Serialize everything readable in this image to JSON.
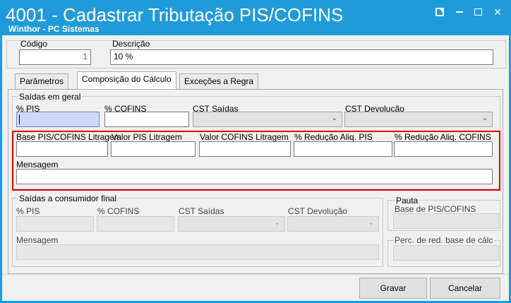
{
  "window": {
    "title": "4001 - Cadastrar Tributação PIS/COFINS",
    "subtitle": "Winthor - PC Sistemas",
    "controls": [
      "edit-icon",
      "minimize-icon",
      "maximize-icon",
      "close-icon"
    ]
  },
  "header": {
    "codigo_label": "Código",
    "codigo_value": "1",
    "descricao_label": "Descrição",
    "descricao_value": "10 %"
  },
  "tabs": [
    {
      "label": "Parâmetros",
      "active": false
    },
    {
      "label": "Composição do Cálculo",
      "active": true
    },
    {
      "label": "Exceções a Regra",
      "active": false
    }
  ],
  "saidas_geral": {
    "title": "Saídas em geral",
    "pis_label": "% PIS",
    "pis_value": "",
    "cofins_label": "% COFINS",
    "cofins_value": "",
    "cst_saidas_label": "CST Saídas",
    "cst_saidas_value": "",
    "cst_devolucao_label": "CST Devolução",
    "cst_devolucao_value": "",
    "base_litragem_label": "Base PIS/COFINS Litragem",
    "valor_pis_litragem_label": "Valor PIS Litragem",
    "valor_cofins_litragem_label": "Valor COFINS Litragem",
    "reducao_pis_label": "% Redução Aliq. PIS",
    "reducao_cofins_label": "% Redução Aliq. COFINS",
    "mensagem_label": "Mensagem",
    "mensagem_value": ""
  },
  "saidas_consumidor": {
    "title": "Saídas a consumidor final",
    "pis_label": "% PIS",
    "cofins_label": "% COFINS",
    "cst_saidas_label": "CST Saídas",
    "cst_devolucao_label": "CST Devolução",
    "mensagem_label": "Mensagem"
  },
  "pauta": {
    "title": "Pauta",
    "base_label": "Base de PIS/COFINS",
    "perc_red_label": "Perc. de red. base de cálc"
  },
  "buttons": {
    "gravar": "Gravar",
    "cancelar": "Cancelar"
  },
  "colors": {
    "titlebar": "#1f9bd9",
    "highlight": "#e00000",
    "focus_field": "#cdd9f6"
  }
}
